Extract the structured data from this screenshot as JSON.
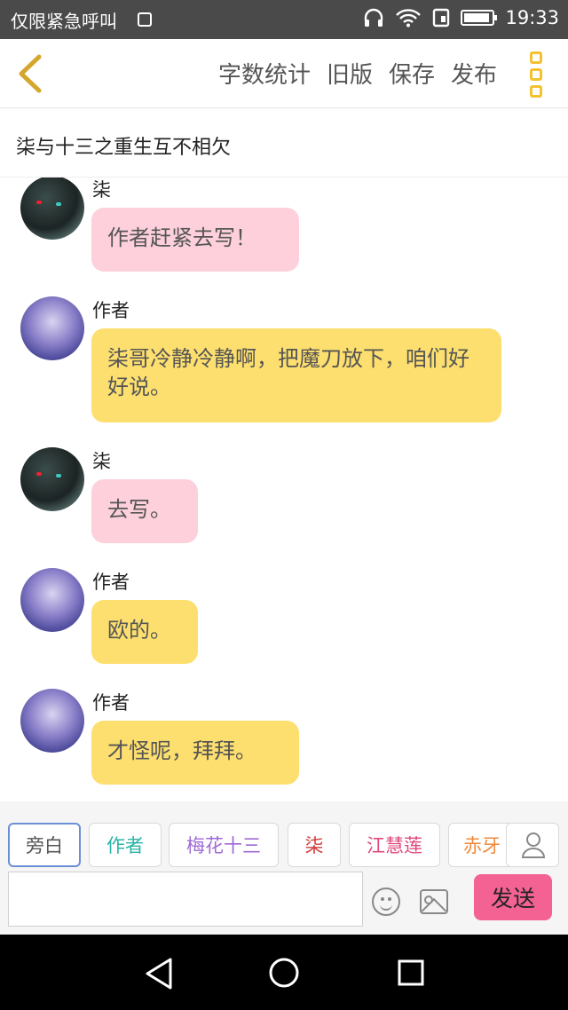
{
  "status_bar": {
    "carrier": "仅限紧急呼叫",
    "time": "19:33"
  },
  "header": {
    "actions": [
      "字数统计",
      "旧版",
      "保存",
      "发布"
    ],
    "back_color": "#d4a72c",
    "more_color": "#f2c230"
  },
  "story": {
    "title": "柒与十三之重生互不相欠"
  },
  "messages": [
    {
      "sender": "柒",
      "text": "作者赶紧去写！",
      "avatar": "avatar-qi",
      "style": "pink"
    },
    {
      "sender": "作者",
      "text": "柒哥冷静冷静啊，把魔刀放下，咱们好好说。",
      "avatar": "avatar-author",
      "style": "yellow"
    },
    {
      "sender": "柒",
      "text": "去写。",
      "avatar": "avatar-qi",
      "style": "pink"
    },
    {
      "sender": "作者",
      "text": "欧的。",
      "avatar": "avatar-author",
      "style": "yellow"
    },
    {
      "sender": "作者",
      "text": "才怪呢，拜拜。",
      "avatar": "avatar-author",
      "style": "yellow"
    }
  ],
  "roles": [
    {
      "label": "旁白",
      "color": "#555555",
      "active": true
    },
    {
      "label": "作者",
      "color": "#2bb3a8"
    },
    {
      "label": "梅花十三",
      "color": "#a06ad6"
    },
    {
      "label": "柒",
      "color": "#d23a3a"
    },
    {
      "label": "江慧莲",
      "color": "#e0487d"
    },
    {
      "label": "赤牙",
      "color": "#f08a3c"
    }
  ],
  "composer": {
    "input_value": "",
    "send_label": "发送"
  },
  "colors": {
    "pink_bubble": "#fdd0dc",
    "yellow_bubble": "#fddf6f",
    "send_button": "#f36292"
  }
}
